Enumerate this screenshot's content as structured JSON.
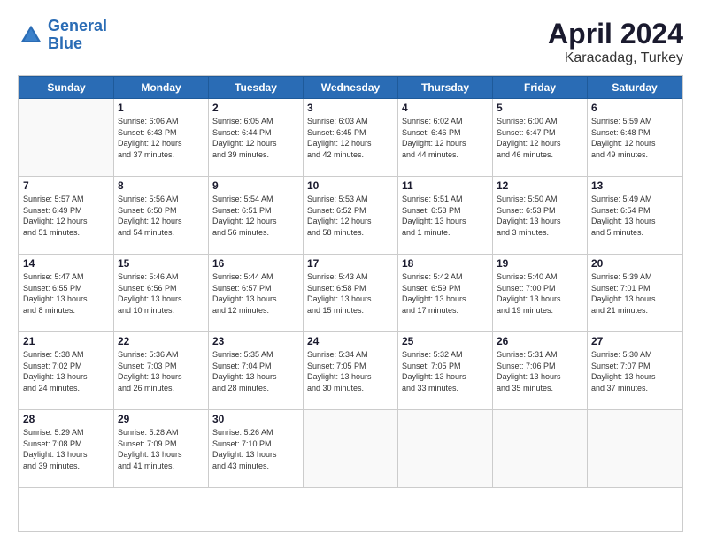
{
  "logo": {
    "line1": "General",
    "line2": "Blue"
  },
  "title": "April 2024",
  "location": "Karacadag, Turkey",
  "headers": [
    "Sunday",
    "Monday",
    "Tuesday",
    "Wednesday",
    "Thursday",
    "Friday",
    "Saturday"
  ],
  "weeks": [
    [
      {
        "day": "",
        "info": ""
      },
      {
        "day": "1",
        "info": "Sunrise: 6:06 AM\nSunset: 6:43 PM\nDaylight: 12 hours\nand 37 minutes."
      },
      {
        "day": "2",
        "info": "Sunrise: 6:05 AM\nSunset: 6:44 PM\nDaylight: 12 hours\nand 39 minutes."
      },
      {
        "day": "3",
        "info": "Sunrise: 6:03 AM\nSunset: 6:45 PM\nDaylight: 12 hours\nand 42 minutes."
      },
      {
        "day": "4",
        "info": "Sunrise: 6:02 AM\nSunset: 6:46 PM\nDaylight: 12 hours\nand 44 minutes."
      },
      {
        "day": "5",
        "info": "Sunrise: 6:00 AM\nSunset: 6:47 PM\nDaylight: 12 hours\nand 46 minutes."
      },
      {
        "day": "6",
        "info": "Sunrise: 5:59 AM\nSunset: 6:48 PM\nDaylight: 12 hours\nand 49 minutes."
      }
    ],
    [
      {
        "day": "7",
        "info": "Sunrise: 5:57 AM\nSunset: 6:49 PM\nDaylight: 12 hours\nand 51 minutes."
      },
      {
        "day": "8",
        "info": "Sunrise: 5:56 AM\nSunset: 6:50 PM\nDaylight: 12 hours\nand 54 minutes."
      },
      {
        "day": "9",
        "info": "Sunrise: 5:54 AM\nSunset: 6:51 PM\nDaylight: 12 hours\nand 56 minutes."
      },
      {
        "day": "10",
        "info": "Sunrise: 5:53 AM\nSunset: 6:52 PM\nDaylight: 12 hours\nand 58 minutes."
      },
      {
        "day": "11",
        "info": "Sunrise: 5:51 AM\nSunset: 6:53 PM\nDaylight: 13 hours\nand 1 minute."
      },
      {
        "day": "12",
        "info": "Sunrise: 5:50 AM\nSunset: 6:53 PM\nDaylight: 13 hours\nand 3 minutes."
      },
      {
        "day": "13",
        "info": "Sunrise: 5:49 AM\nSunset: 6:54 PM\nDaylight: 13 hours\nand 5 minutes."
      }
    ],
    [
      {
        "day": "14",
        "info": "Sunrise: 5:47 AM\nSunset: 6:55 PM\nDaylight: 13 hours\nand 8 minutes."
      },
      {
        "day": "15",
        "info": "Sunrise: 5:46 AM\nSunset: 6:56 PM\nDaylight: 13 hours\nand 10 minutes."
      },
      {
        "day": "16",
        "info": "Sunrise: 5:44 AM\nSunset: 6:57 PM\nDaylight: 13 hours\nand 12 minutes."
      },
      {
        "day": "17",
        "info": "Sunrise: 5:43 AM\nSunset: 6:58 PM\nDaylight: 13 hours\nand 15 minutes."
      },
      {
        "day": "18",
        "info": "Sunrise: 5:42 AM\nSunset: 6:59 PM\nDaylight: 13 hours\nand 17 minutes."
      },
      {
        "day": "19",
        "info": "Sunrise: 5:40 AM\nSunset: 7:00 PM\nDaylight: 13 hours\nand 19 minutes."
      },
      {
        "day": "20",
        "info": "Sunrise: 5:39 AM\nSunset: 7:01 PM\nDaylight: 13 hours\nand 21 minutes."
      }
    ],
    [
      {
        "day": "21",
        "info": "Sunrise: 5:38 AM\nSunset: 7:02 PM\nDaylight: 13 hours\nand 24 minutes."
      },
      {
        "day": "22",
        "info": "Sunrise: 5:36 AM\nSunset: 7:03 PM\nDaylight: 13 hours\nand 26 minutes."
      },
      {
        "day": "23",
        "info": "Sunrise: 5:35 AM\nSunset: 7:04 PM\nDaylight: 13 hours\nand 28 minutes."
      },
      {
        "day": "24",
        "info": "Sunrise: 5:34 AM\nSunset: 7:05 PM\nDaylight: 13 hours\nand 30 minutes."
      },
      {
        "day": "25",
        "info": "Sunrise: 5:32 AM\nSunset: 7:05 PM\nDaylight: 13 hours\nand 33 minutes."
      },
      {
        "day": "26",
        "info": "Sunrise: 5:31 AM\nSunset: 7:06 PM\nDaylight: 13 hours\nand 35 minutes."
      },
      {
        "day": "27",
        "info": "Sunrise: 5:30 AM\nSunset: 7:07 PM\nDaylight: 13 hours\nand 37 minutes."
      }
    ],
    [
      {
        "day": "28",
        "info": "Sunrise: 5:29 AM\nSunset: 7:08 PM\nDaylight: 13 hours\nand 39 minutes."
      },
      {
        "day": "29",
        "info": "Sunrise: 5:28 AM\nSunset: 7:09 PM\nDaylight: 13 hours\nand 41 minutes."
      },
      {
        "day": "30",
        "info": "Sunrise: 5:26 AM\nSunset: 7:10 PM\nDaylight: 13 hours\nand 43 minutes."
      },
      {
        "day": "",
        "info": ""
      },
      {
        "day": "",
        "info": ""
      },
      {
        "day": "",
        "info": ""
      },
      {
        "day": "",
        "info": ""
      }
    ]
  ]
}
